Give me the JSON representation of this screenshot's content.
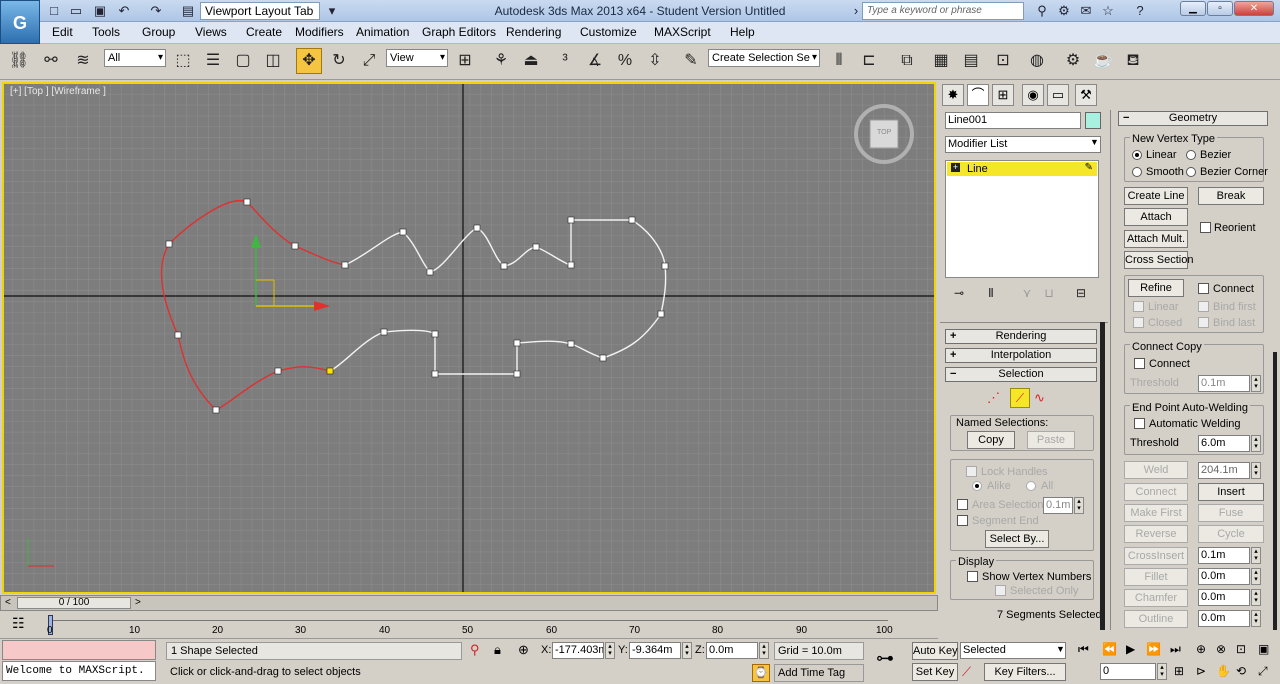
{
  "app": {
    "logo": "G",
    "workspace": "Viewport Layout Tab",
    "title": "Autodesk 3ds Max  2013 x64  - Student Version   Untitled",
    "search_placeholder": "Type a keyword or phrase"
  },
  "menu": [
    "Edit",
    "Tools",
    "Group",
    "Views",
    "Create",
    "Modifiers",
    "Animation",
    "Graph Editors",
    "Rendering",
    "Customize",
    "MAXScript",
    "Help"
  ],
  "toolbar": {
    "filter": "All",
    "ref_coord": "View",
    "selection_set": "Create Selection Se"
  },
  "viewport": {
    "label": "[+] [Top ] [Wireframe ]",
    "viewcube": "TOP"
  },
  "panel": {
    "object_name": "Line001",
    "object_color": "#a8f0e0",
    "modifier_list": "Modifier List",
    "stack_item": "Line",
    "rollouts": {
      "rendering": "Rendering",
      "interpolation": "Interpolation",
      "selection": "Selection",
      "geometry": "Geometry"
    },
    "selection": {
      "named_selections": "Named Selections:",
      "copy": "Copy",
      "paste": "Paste",
      "lock_handles": "Lock Handles",
      "alike": "Alike",
      "all": "All",
      "area_selection": "Area Selection:",
      "area_value": "0.1m",
      "segment_end": "Segment End",
      "select_by": "Select By...",
      "display": "Display",
      "show_vertex_numbers": "Show Vertex Numbers",
      "selected_only": "Selected Only",
      "summary": "7 Segments Selected"
    },
    "geometry": {
      "new_vertex_type": "New Vertex Type",
      "linear": "Linear",
      "bezier": "Bezier",
      "smooth": "Smooth",
      "bezier_corner": "Bezier Corner",
      "create_line": "Create Line",
      "break": "Break",
      "attach": "Attach",
      "reorient": "Reorient",
      "attach_mult": "Attach Mult.",
      "cross_section": "Cross Section",
      "refine": "Refine",
      "connect": "Connect",
      "r_linear": "Linear",
      "bind_first": "Bind first",
      "closed": "Closed",
      "bind_last": "Bind last",
      "connect_copy": "Connect Copy",
      "cc_connect": "Connect",
      "threshold": "Threshold",
      "cc_threshold": "0.1m",
      "end_point": "End Point Auto-Welding",
      "auto_weld": "Automatic Welding",
      "ep_threshold": "6.0m",
      "weld": "Weld",
      "weld_value": "204.1m",
      "g_connect": "Connect",
      "insert": "Insert",
      "make_first": "Make First",
      "fuse": "Fuse",
      "reverse": "Reverse",
      "cycle": "Cycle",
      "crossinsert": "CrossInsert",
      "crossinsert_value": "0.1m",
      "fillet": "Fillet",
      "fillet_value": "0.0m",
      "chamfer": "Chamfer",
      "chamfer_value": "0.0m",
      "outline": "Outline",
      "outline_value": "0.0m"
    }
  },
  "timeline": {
    "slider": "0 / 100",
    "ticks": [
      "0",
      "10",
      "20",
      "30",
      "40",
      "50",
      "60",
      "70",
      "80",
      "90",
      "100"
    ]
  },
  "status": {
    "maxscript": "Welcome to MAXScript.",
    "selected": "1 Shape Selected",
    "prompt": "Click or click-and-drag to select objects",
    "x_label": "X:",
    "x": "-177.403m",
    "y_label": "Y:",
    "y": "-9.364m",
    "z_label": "Z:",
    "z": "0.0m",
    "grid": "Grid = 10.0m",
    "add_time_tag": "Add Time Tag",
    "auto_key": "Auto Key",
    "set_key": "Set Key",
    "key_mode": "Selected",
    "key_filters": "Key Filters...",
    "frame": "0"
  }
}
